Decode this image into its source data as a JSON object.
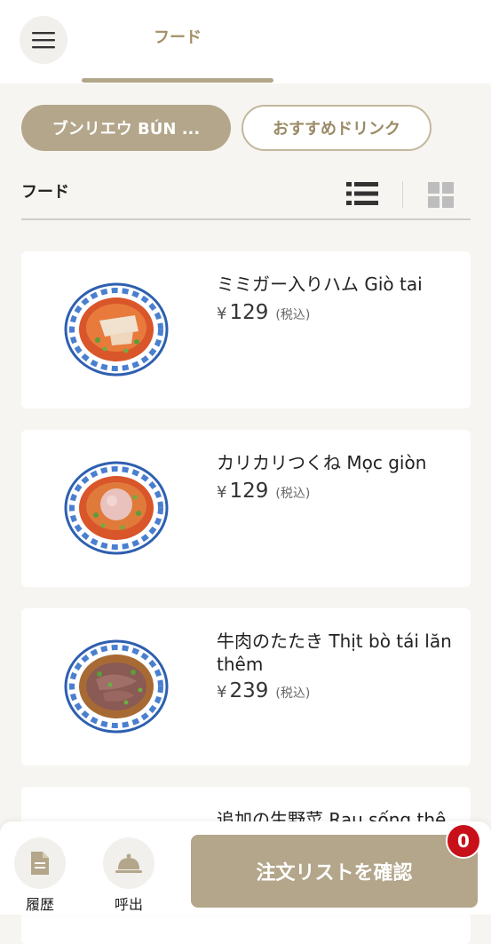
{
  "header": {
    "tab_label": "フード"
  },
  "categories": [
    {
      "label": "ブンリエウ BÚN ...",
      "active": true
    },
    {
      "label": "おすすめドリンク",
      "active": false
    }
  ],
  "section": {
    "title": "フード"
  },
  "items": [
    {
      "name": "ミミガー入りハム Giò tai",
      "currency": "¥",
      "price": "129",
      "tax": "(税込)"
    },
    {
      "name": "カリカリつくね Mọc giòn",
      "currency": "¥",
      "price": "129",
      "tax": "(税込)"
    },
    {
      "name": "牛肉のたたき Thịt bò tái lăn thêm",
      "currency": "¥",
      "price": "239",
      "tax": "(税込)"
    },
    {
      "name": "追加の生野菜 Rau sống thê"
    }
  ],
  "bottom_nav": {
    "history_label": "履歴",
    "call_label": "呼出",
    "order_button_label": "注文リストを確認",
    "cart_count": "0"
  },
  "colors": {
    "accent": "#b3a68a",
    "badge": "#c8101a",
    "background": "#f7f5f1"
  }
}
